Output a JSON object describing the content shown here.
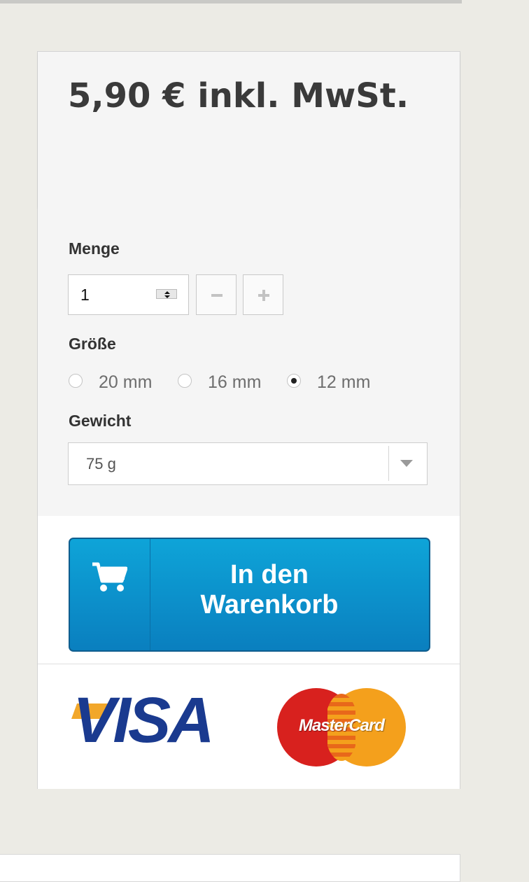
{
  "price": {
    "text": "5,90 € inkl. MwSt."
  },
  "quantity": {
    "label": "Menge",
    "value": "1",
    "minus_icon": "minus-icon",
    "plus_icon": "plus-icon"
  },
  "size": {
    "label": "Größe",
    "options": [
      {
        "label": "20 mm",
        "checked": false
      },
      {
        "label": "16 mm",
        "checked": false
      },
      {
        "label": "12 mm",
        "checked": true
      }
    ]
  },
  "weight": {
    "label": "Gewicht",
    "selected": "75 g"
  },
  "cart_button": {
    "label": "In den Warenkorb",
    "icon": "cart-icon",
    "color": "#0a8fcc"
  },
  "payment": {
    "visa": "VISA",
    "mastercard": "MasterCard"
  }
}
